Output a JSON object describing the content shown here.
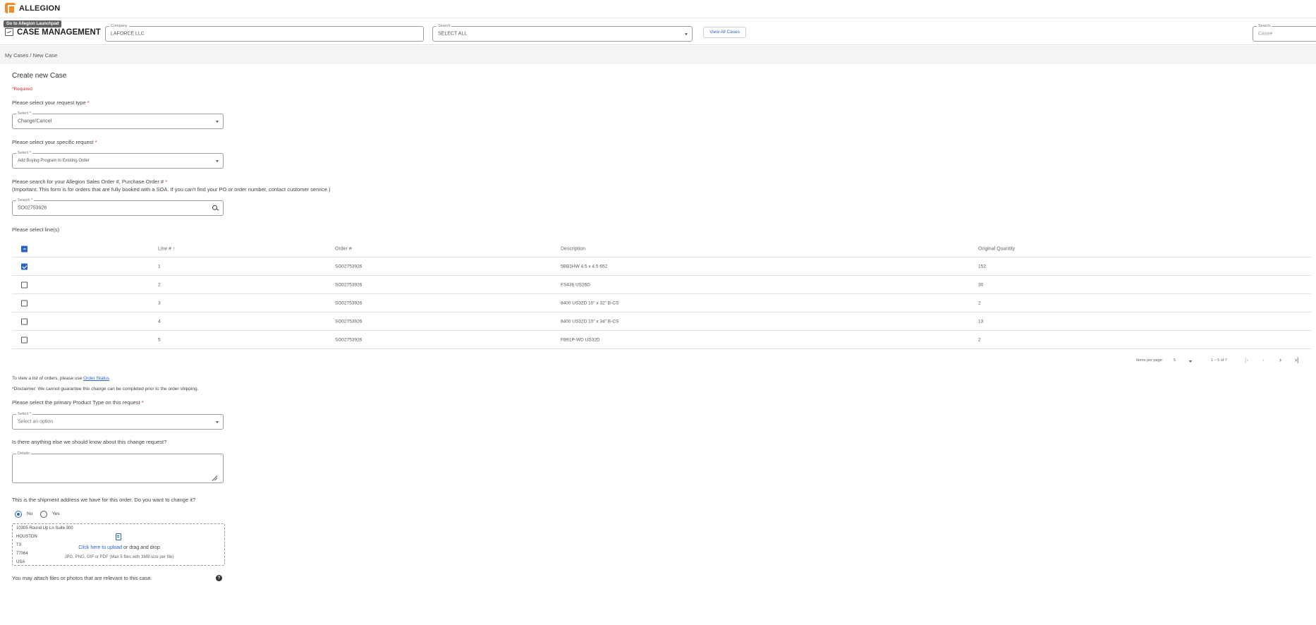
{
  "brand": {
    "name": "ALLEGION",
    "tooltip": "Go to Allegion Launchpad"
  },
  "app": {
    "title": "CASE MANAGEMENT"
  },
  "header": {
    "company": {
      "label": "Company",
      "value": "LAFORCE LLC"
    },
    "search_filter": {
      "label": "Search",
      "value": "SELECT ALL"
    },
    "view_all_label": "View All Cases",
    "case_search": {
      "label": "Search",
      "placeholder": "Case#"
    }
  },
  "breadcrumb": "My Cases / New Case",
  "form": {
    "title": "Create new Case",
    "required_note": "*Required",
    "request_type": {
      "question": "Please select your request type",
      "star": " *",
      "label": "Select *",
      "value": "Change/Cancel"
    },
    "specific_request": {
      "question": "Please select your specific request",
      "star": " *",
      "label": "Select *",
      "value": "Add Buying Program to Existing Order"
    },
    "order_search": {
      "question": "Please search for your Allegion Sales Order #, Purchase Order #",
      "star": " *",
      "note": "(Important: This form is for orders that are fully booked with a SOA. If you can't find your PO or order number, contact customer service.)",
      "label": "Search *",
      "value": "SO02753926"
    },
    "lines_label": "Please select line(s)",
    "table": {
      "headers": {
        "line": "Line #",
        "sort_arrow": "↑",
        "order": "Order #",
        "description": "Description",
        "quantity": "Original Quantity"
      },
      "rows": [
        {
          "checked": true,
          "line": "1",
          "order": "SO02753926",
          "description": "5BB1HW 4.5 x 4.5 652",
          "quantity": "152"
        },
        {
          "checked": false,
          "line": "2",
          "order": "SO02753926",
          "description": "FS436 US26D",
          "quantity": "30"
        },
        {
          "checked": false,
          "line": "3",
          "order": "SO02753926",
          "description": "8400 US32D 10\" x 32\" B-CS",
          "quantity": "2"
        },
        {
          "checked": false,
          "line": "4",
          "order": "SO02753926",
          "description": "8400 US32D 10\" x 34\" B-CS",
          "quantity": "13"
        },
        {
          "checked": false,
          "line": "5",
          "order": "SO02753926",
          "description": "FB61P-WD US32D",
          "quantity": "2"
        }
      ],
      "paginator": {
        "items_per_page_label": "Items per page:",
        "items_per_page": "5",
        "range": "1 – 5 of 7"
      }
    },
    "order_status": {
      "prefix": "To view a list of orders, please use ",
      "link": "Order Status"
    },
    "disclaimer": "*Disclaimer: We cannot guarantee this change can be completed prior to the order shipping.",
    "product_type": {
      "question": "Please select the primary Product Type on this request",
      "star": " *",
      "label": "Select *",
      "placeholder": "Select an option"
    },
    "details": {
      "question": "Is there anything else we should know about this change request?",
      "label": "Details"
    },
    "address": {
      "question": "This is the shipment address we have for this order.  Do you want to change it?",
      "options": {
        "no": "No",
        "yes": "Yes"
      },
      "lines": [
        "10305 Round Up Ln Suite 300",
        "HOUSTON",
        "TX",
        "77064",
        "USA"
      ]
    },
    "attach": {
      "label": "You may attach files or photos that are relevant to this case.",
      "help_glyph": "?",
      "upload_link": "Click here to upload",
      "upload_suffix": " or drag and drop",
      "hint": "JPG, PNG, GIF or PDF (Max 5 files with 3MB size per file)"
    }
  },
  "colors": {
    "accent": "#2a64c5",
    "brand": "#f28c28",
    "required": "#d32f2f"
  }
}
